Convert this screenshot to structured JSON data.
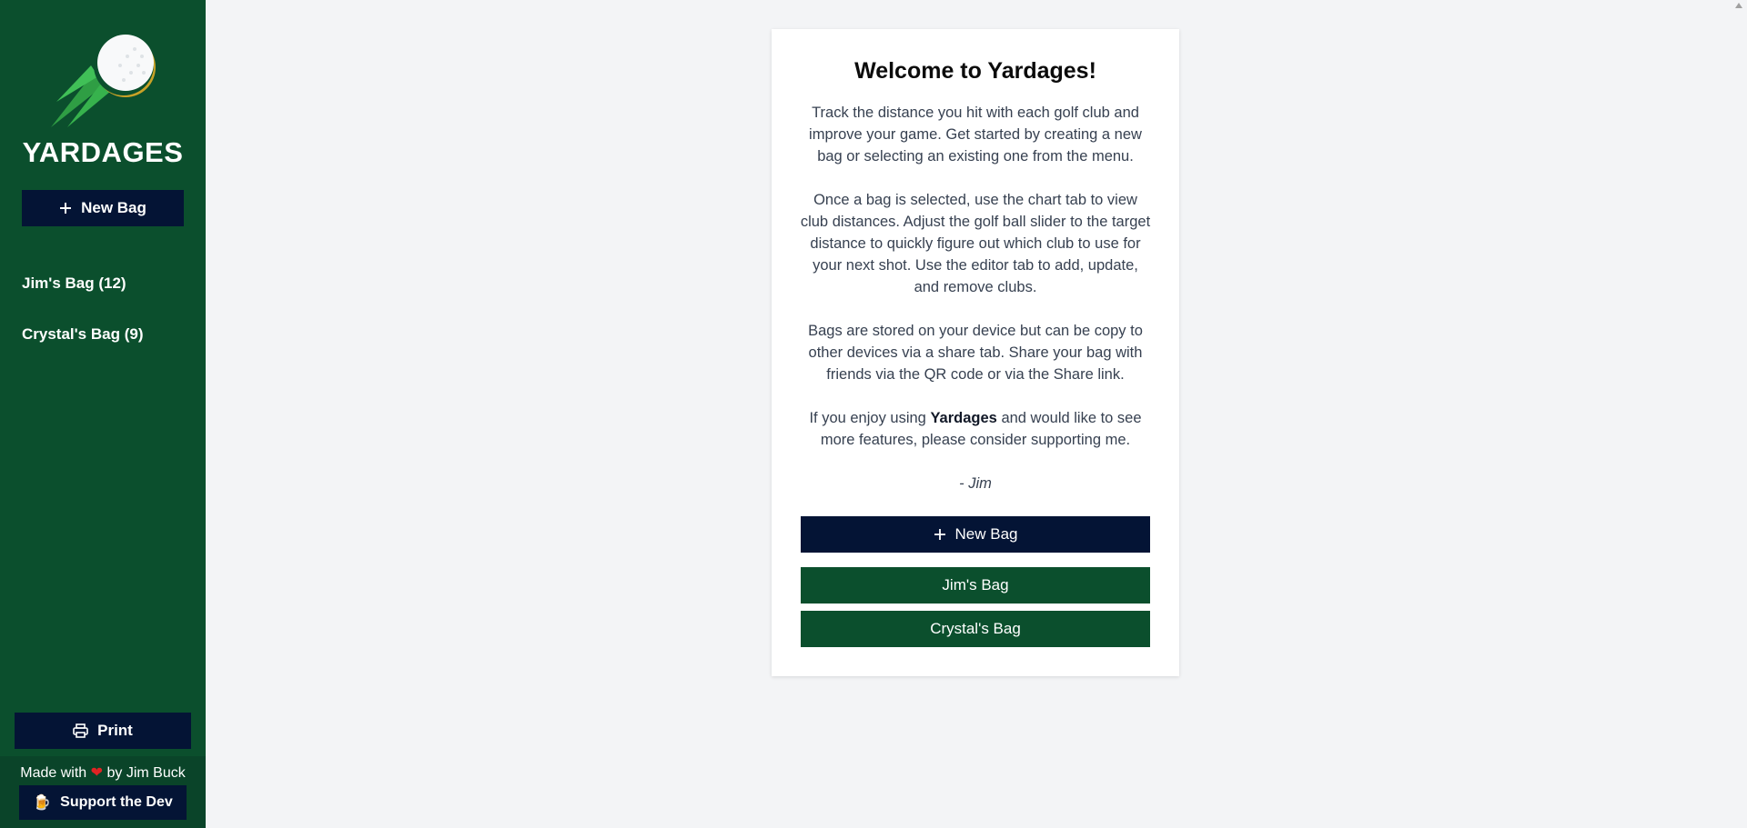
{
  "sidebar": {
    "brand": "YARDAGES",
    "new_bag_label": "New Bag",
    "bags": [
      {
        "label": "Jim's Bag (12)"
      },
      {
        "label": "Crystal's Bag (9)"
      }
    ],
    "print_label": "Print",
    "footer": {
      "made_prefix": "Made with",
      "heart": "❤",
      "made_suffix": "by Jim Buck",
      "support_icon": "🍺",
      "support_label": "Support the Dev"
    }
  },
  "card": {
    "title": "Welcome to Yardages!",
    "p1": "Track the distance you hit with each golf club and improve your game. Get started by creating a new bag or selecting an existing one from the menu.",
    "p2": "Once a bag is selected, use the chart tab to view club distances. Adjust the golf ball slider to the target distance to quickly figure out which club to use for your next shot. Use the editor tab to add, update, and remove clubs.",
    "p3": "Bags are stored on your device but can be copy to other devices via a share tab. Share your bag with friends via the QR code or via the Share link.",
    "p4_prefix": "If you enjoy using",
    "p4_bold": "Yardages",
    "p4_suffix": "and would like to see more features, please consider supporting me.",
    "signature": "- Jim",
    "new_bag_label": "New Bag",
    "bag_buttons": [
      {
        "label": "Jim's Bag"
      },
      {
        "label": "Crystal's Bag"
      }
    ]
  },
  "icons": {
    "logo": "golf-ball-logo-icon",
    "plus": "plus-icon",
    "printer": "printer-icon",
    "beer": "beer-icon"
  },
  "colors": {
    "sidebar_green": "#0b4f2d",
    "navy": "#041435",
    "background": "#f3f4f6"
  }
}
